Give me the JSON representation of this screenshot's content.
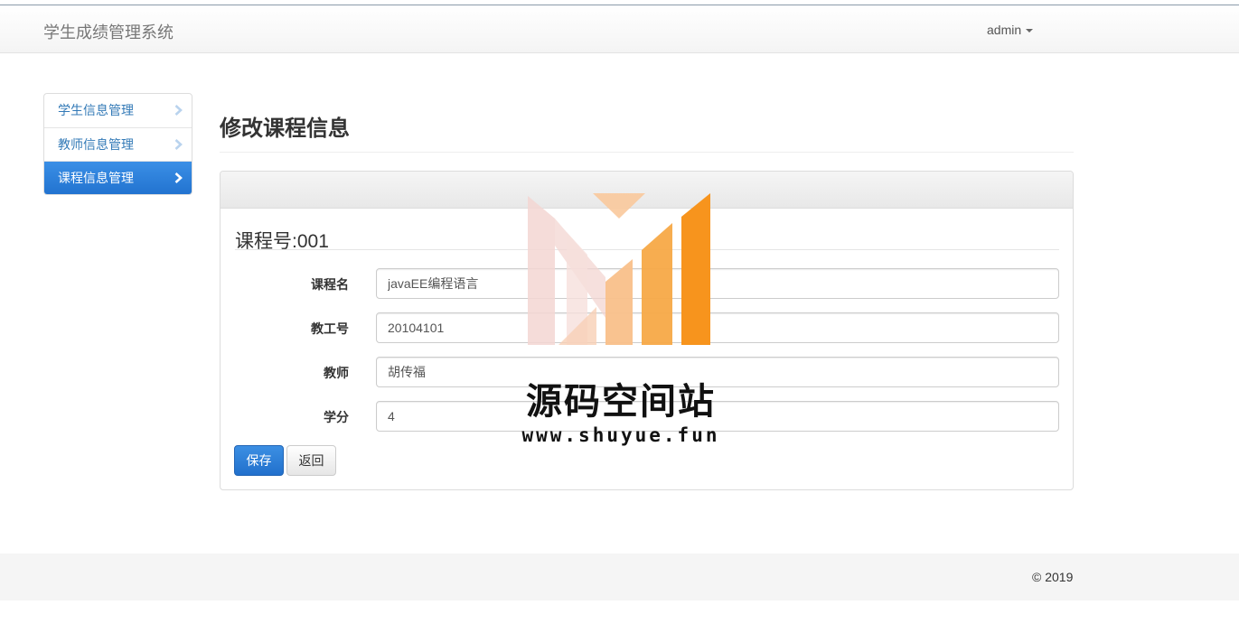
{
  "navbar": {
    "brand": "学生成绩管理系统",
    "user": "admin"
  },
  "sidebar": {
    "items": [
      {
        "label": "学生信息管理",
        "active": false
      },
      {
        "label": "教师信息管理",
        "active": false
      },
      {
        "label": "课程信息管理",
        "active": true
      }
    ]
  },
  "page": {
    "title": "修改课程信息"
  },
  "form": {
    "legend": "课程号:001",
    "fields": [
      {
        "label": "课程名",
        "value": "javaEE编程语言"
      },
      {
        "label": "教工号",
        "value": "20104101"
      },
      {
        "label": "教师",
        "value": "胡传福"
      },
      {
        "label": "学分",
        "value": "4"
      }
    ],
    "save_label": "保存",
    "back_label": "返回"
  },
  "watermark": {
    "text": "源码空间站",
    "url": "www.shuyue.fun"
  },
  "footer": {
    "copyright": "© 2019"
  },
  "colors": {
    "accent": "#2c7fd8",
    "watermark_orange": "#f7941d"
  }
}
